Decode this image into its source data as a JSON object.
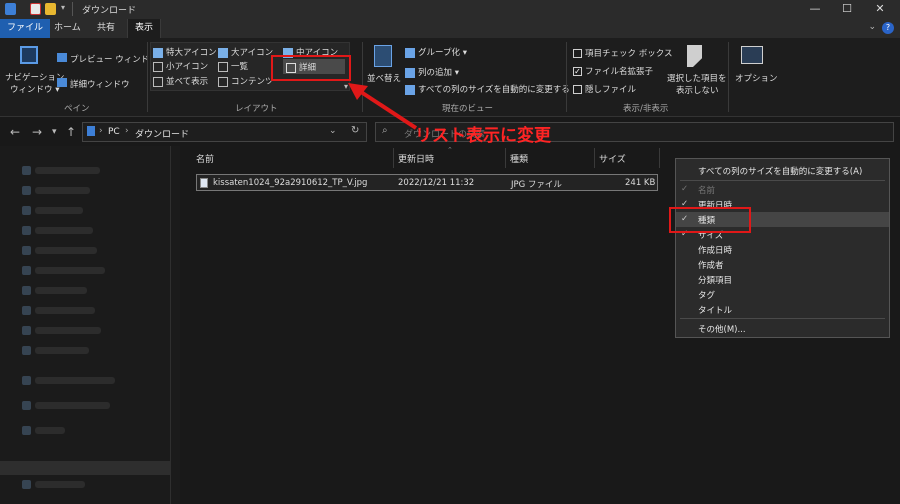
{
  "window": {
    "title": "ダウンロード",
    "minimize_label": "—",
    "maximize_label": "☐",
    "close_label": "✕"
  },
  "tabs": [
    {
      "label": "ファイル"
    },
    {
      "label": "ホーム"
    },
    {
      "label": "共有"
    },
    {
      "label": "表示"
    }
  ],
  "help_label": "?",
  "ribbon": {
    "pane": {
      "nav_pane": "ナビゲーション",
      "nav_pane2": "ウィンドウ ▾",
      "preview": "プレビュー ウィンドウ",
      "details_pane": "詳細ウィンドウ",
      "group": "ペイン"
    },
    "layout": {
      "xl_icons": "特大アイコン",
      "large_icons": "大アイコン",
      "medium_icons": "中アイコン",
      "small_icons": "小アイコン",
      "list": "一覧",
      "details": "詳細",
      "tiles": "並べて表示",
      "content": "コンテンツ",
      "group": "レイアウト"
    },
    "current_view": {
      "sort": "並べ替え",
      "group_by": "グループ化 ▾",
      "add_columns": "列の追加 ▾",
      "fit_columns": "すべての列のサイズを自動的に変更する",
      "group": "現在のビュー"
    },
    "show_hide": {
      "item_checkboxes": "項目チェック ボックス",
      "file_extensions": "ファイル名拡張子",
      "hidden_items": "隠しファイル",
      "hide_selected_1": "選択した項目を",
      "hide_selected_2": "表示しない",
      "group": "表示/非表示"
    },
    "options": "オプション"
  },
  "address": {
    "path_pc": "PC",
    "path_sep": "›",
    "path_folder": "ダウンロード",
    "search_placeholder": "ダウンロードの検索"
  },
  "columns": {
    "name": "名前",
    "date": "更新日時",
    "type": "種類",
    "size": "サイズ"
  },
  "files": [
    {
      "name": "kissaten1024_92a2910612_TP_V.jpg",
      "date": "2022/12/21 11:32",
      "type": "JPG ファイル",
      "size": "241 KB"
    }
  ],
  "context_menu": {
    "fit_all": "すべての列のサイズを自動的に変更する(A)",
    "items": [
      {
        "label": "名前",
        "checked": true,
        "disabled": true
      },
      {
        "label": "更新日時",
        "checked": true
      },
      {
        "label": "種類",
        "checked": true,
        "highlighted": true
      },
      {
        "label": "サイズ",
        "checked": true
      },
      {
        "label": "作成日時",
        "checked": false
      },
      {
        "label": "作成者",
        "checked": false
      },
      {
        "label": "分類項目",
        "checked": false
      },
      {
        "label": "タグ",
        "checked": false
      },
      {
        "label": "タイトル",
        "checked": false
      }
    ],
    "more": "その他(M)..."
  },
  "annotation": {
    "text": "リスト表示に変更",
    "color": "#ff2424"
  },
  "colors": {
    "accent": "#1f5fb0",
    "background": "#191919",
    "ribbon": "#1d1d1d"
  }
}
